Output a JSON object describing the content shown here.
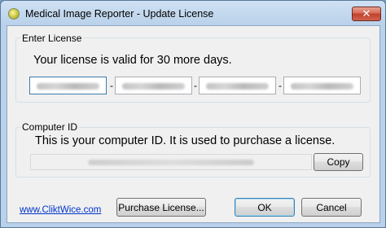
{
  "window": {
    "title": "Medical Image Reporter - Update License",
    "close_glyph": "✕",
    "icon": "app-icon"
  },
  "license_group": {
    "legend": "Enter License",
    "status_text": "Your license is valid for 30 more days.",
    "key_separator": "-",
    "key_fields": [
      "",
      "",
      "",
      ""
    ]
  },
  "computer_id_group": {
    "legend": "Computer ID",
    "description": "This is your computer ID.  It is used to purchase a license.",
    "copy_label": "Copy"
  },
  "footer": {
    "website_link": "www.CliktWice.com",
    "purchase_label": "Purchase License...",
    "ok_label": "OK",
    "cancel_label": "Cancel"
  },
  "colors": {
    "link": "#0033cc",
    "title_bar": "#b9d1ea",
    "close_button": "#c0412b"
  }
}
